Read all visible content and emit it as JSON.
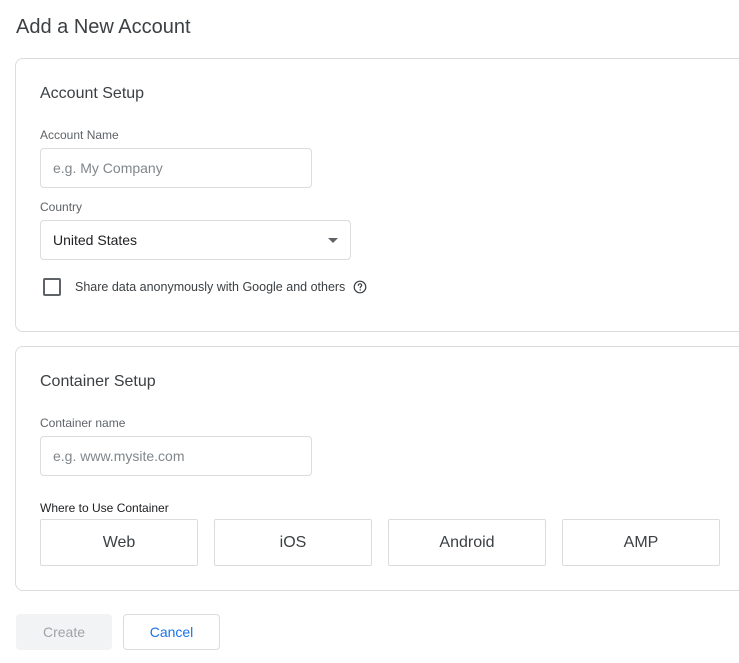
{
  "page": {
    "title": "Add a New Account"
  },
  "account_setup": {
    "title": "Account Setup",
    "account_name": {
      "label": "Account Name",
      "placeholder": "e.g. My Company",
      "value": ""
    },
    "country": {
      "label": "Country",
      "selected": "United States"
    },
    "share_data": {
      "label": "Share data anonymously with Google and others",
      "checked": false,
      "help_icon": "help-circle-icon"
    }
  },
  "container_setup": {
    "title": "Container Setup",
    "container_name": {
      "label": "Container name",
      "placeholder": "e.g. www.mysite.com",
      "value": ""
    },
    "where_label": "Where to Use Container",
    "platforms": [
      "Web",
      "iOS",
      "Android",
      "AMP"
    ]
  },
  "actions": {
    "create_label": "Create",
    "cancel_label": "Cancel"
  },
  "colors": {
    "accent": "#1a73e8",
    "border": "#dadce0",
    "disabled_bg": "#f1f3f4"
  }
}
